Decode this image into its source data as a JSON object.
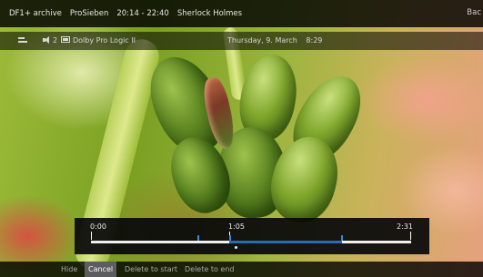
{
  "header": {
    "service": "DF1+ archive",
    "channel": "ProSieben",
    "time_range": "20:14 - 22:40",
    "programme": "Sherlock Holmes",
    "back_label": "Bac"
  },
  "info_bar": {
    "subtitle_icon": "subtitles-icon",
    "speaker_icon": "speaker-icon",
    "audio_track_count": "2",
    "dolby_icon": "dolby-icon",
    "audio_format": "Dolby Pro Logic II",
    "date": "Thursday, 9. March",
    "clock": "8:29"
  },
  "timeline": {
    "start_label": "0:00",
    "position_label": "1:05",
    "end_label": "2:31",
    "duration_minutes": 151,
    "position_minutes": 65,
    "cut_start_minutes": 65,
    "cut_end_minutes": 118,
    "marker_minutes": [
      50,
      65,
      118
    ],
    "handle_minutes": 68,
    "colors": {
      "track": "#f0f0f0",
      "cut_range": "#2b69b8",
      "marker": "#3d86dc"
    }
  },
  "actions": {
    "hide": "Hide",
    "cancel": "Cancel",
    "delete_to_start": "Delete to start",
    "delete_to_end": "Delete to end",
    "selected": "cancel"
  }
}
